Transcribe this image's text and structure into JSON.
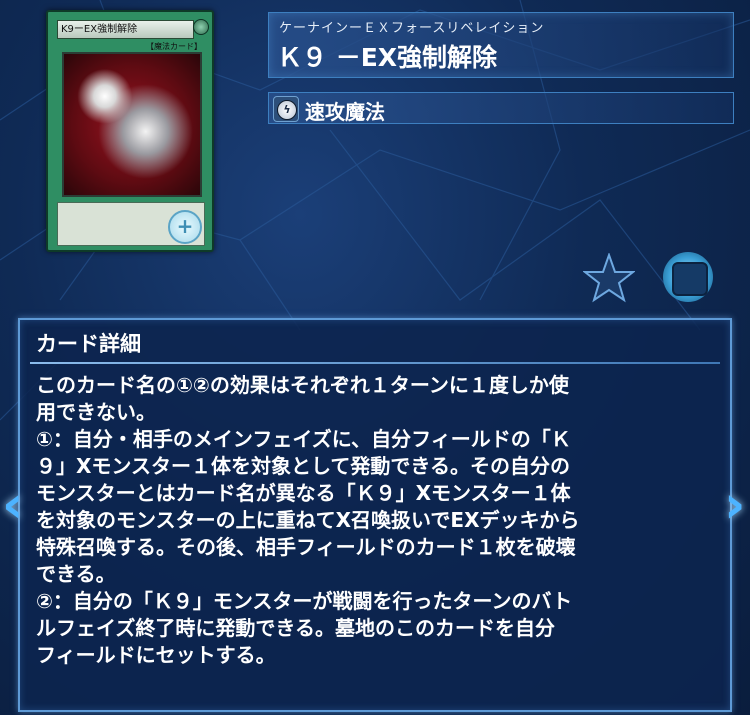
{
  "card": {
    "name_ruby": "ケーナインーＥＸフォースリベレイション",
    "name": "Ｋ９ －EX強制解除",
    "art_name": "K9ーEX強制解除",
    "art_type": "【魔法カード】",
    "type_label": "速攻魔法",
    "type_icon": "quick-play-spell-icon"
  },
  "details": {
    "header": "カード詳細",
    "text": "このカード名の①②の効果はそれぞれ１ターンに１度しか使\n用できない。\n①：自分・相手のメインフェイズに、自分フィールドの「Ｋ\n９」Xモンスター１体を対象として発動できる。その自分の\nモンスターとはカード名が異なる「Ｋ９」Xモンスター１体\nを対象のモンスターの上に重ねてX召喚扱いでEXデッキから\n特殊召喚する。その後、相手フィールドのカード１枚を破壊\nできる。\n②：自分の「Ｋ９」モンスターが戦闘を行ったターンのバト\nルフェイズ終了時に発動できる。墓地のこのカードを自分\nフィールドにセットする。"
  },
  "icons": {
    "zoom": "zoom-in-icon",
    "favorite": "star-icon",
    "deck": "deck-pot-icon",
    "prev": "chevron-left-icon",
    "next": "chevron-right-icon"
  },
  "colors": {
    "card_frame": "#2f8e63",
    "panel_border": "#5e9ad6",
    "arrow": "#4db3ff"
  }
}
